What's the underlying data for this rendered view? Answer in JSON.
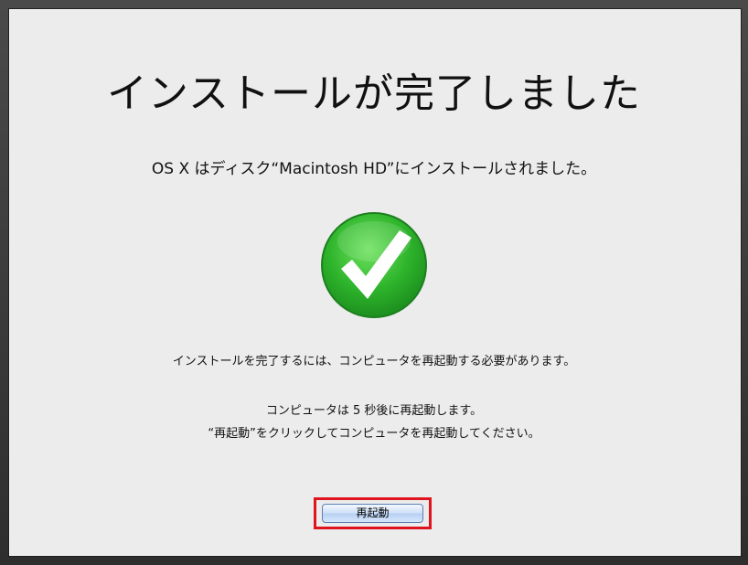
{
  "installer": {
    "title": "インストールが完了しました",
    "subtitle": "OS X はディスク“Macintosh HD”にインストールされました。",
    "message": "インストールを完了するには、コンピュータを再起動する必要があります。",
    "countdown": "コンピュータは 5 秒後に再起動します。",
    "instruction": "“再起動”をクリックしてコンピュータを再起動してください。",
    "restart_button": "再起動"
  },
  "colors": {
    "check_green": "#2fb52c",
    "highlight_red": "#e0141e"
  },
  "icons": [
    "checkmark-icon"
  ]
}
